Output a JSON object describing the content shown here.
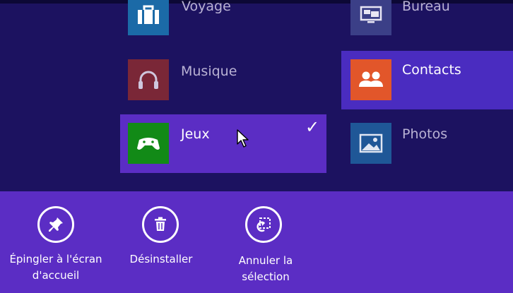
{
  "apps": [
    {
      "label": "Voyage",
      "icon": "suitcase-icon",
      "color": "#1b6aa7",
      "state": "normal"
    },
    {
      "label": "Bureau",
      "icon": "desktop-icon",
      "color": "#3b3f87",
      "state": "normal"
    },
    {
      "label": "Musique",
      "icon": "headphones-icon",
      "color": "#7a2737",
      "state": "dim"
    },
    {
      "label": "Contacts",
      "icon": "people-icon",
      "color": "#e2562a",
      "state": "highlighted"
    },
    {
      "label": "Jeux",
      "icon": "gamepad-icon",
      "color": "#128a17",
      "state": "selected"
    },
    {
      "label": "Photos",
      "icon": "photo-icon",
      "color": "#1f5797",
      "state": "normal"
    }
  ],
  "selection_check": "✓",
  "appbar": {
    "commands": [
      {
        "label": "Épingler à l'écran\nd'accueil",
        "icon": "pin-icon"
      },
      {
        "label": "Désinstaller",
        "icon": "trash-icon"
      },
      {
        "label": "Annuler la\nsélection",
        "icon": "clear-selection-icon"
      }
    ]
  },
  "colors": {
    "background": "#1c1260",
    "appbar": "#5b2dc4",
    "selected_tile_bg": "#5b2dc4"
  }
}
